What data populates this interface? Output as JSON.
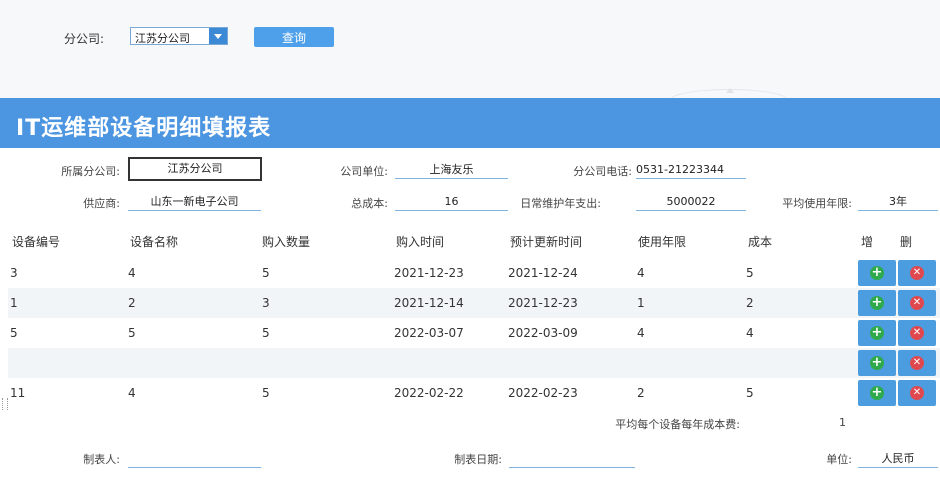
{
  "filter": {
    "label": "分公司:",
    "selected": "江苏分公司",
    "query_label": "查询"
  },
  "header": {
    "title": "IT运维部设备明细填报表"
  },
  "form": {
    "branch_label": "所属分公司:",
    "branch_value": "江苏分公司",
    "unit_label": "公司单位:",
    "unit_value": "上海友乐",
    "phone_label": "分公司电话:",
    "phone_value": "0531-21223344",
    "supplier_label": "供应商:",
    "supplier_value": "山东一新电子公司",
    "total_cost_label": "总成本:",
    "total_cost_value": "16",
    "maint_label": "日常维护年支出:",
    "maint_value": "5000022",
    "avg_years_label": "平均使用年限:",
    "avg_years_value": "3年"
  },
  "table": {
    "headers": [
      "设备编号",
      "设备名称",
      "购入数量",
      "购入时间",
      "预计更新时间",
      "使用年限",
      "成本",
      "增",
      "删"
    ],
    "rows": [
      [
        "3",
        "4",
        "5",
        "2021-12-23",
        "2021-12-24",
        "4",
        "5"
      ],
      [
        "1",
        "2",
        "3",
        "2021-12-14",
        "2021-12-23",
        "1",
        "2"
      ],
      [
        "5",
        "5",
        "5",
        "2022-03-07",
        "2022-03-09",
        "4",
        "4"
      ],
      [
        "",
        "",
        "",
        "",
        "",
        "",
        ""
      ],
      [
        "11",
        "4",
        "5",
        "2022-02-22",
        "2022-02-23",
        "2",
        "5"
      ]
    ]
  },
  "summary": {
    "label": "平均每个设备每年成本费:",
    "value": "1"
  },
  "footer": {
    "maker_label": "制表人:",
    "maker_value": "",
    "date_label": "制表日期:",
    "date_value": "",
    "currency_label": "单位:",
    "currency_value": "人民币"
  },
  "colors": {
    "accent": "#4c95e0",
    "add": "#2eaa4c",
    "delete": "#e0484f"
  }
}
